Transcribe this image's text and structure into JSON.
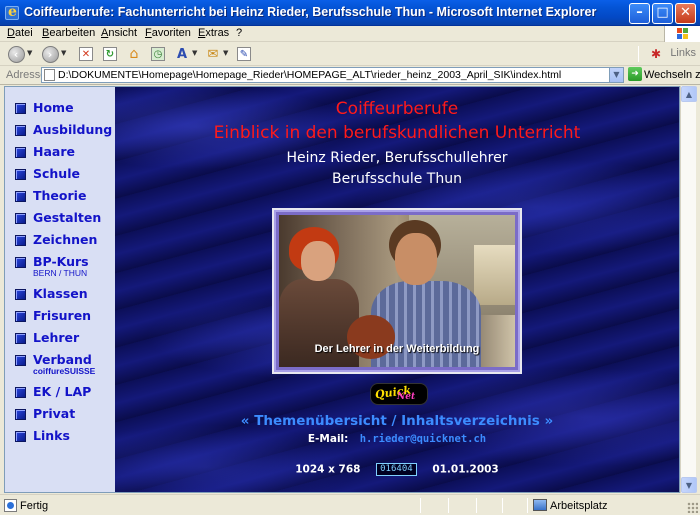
{
  "window": {
    "title": "Coiffeurberufe: Fachunterricht bei Heinz Rieder, Berufsschule Thun - Microsoft Internet Explorer"
  },
  "menu": [
    "Datei",
    "Bearbeiten",
    "Ansicht",
    "Favoriten",
    "Extras",
    "?"
  ],
  "toolbar": {
    "links_label": "Links",
    "icons": [
      "back-icon",
      "forward-icon",
      "stop-icon",
      "refresh-icon",
      "home-icon",
      "history-icon",
      "font-size-icon",
      "mail-icon",
      "edit-icon"
    ]
  },
  "address": {
    "label": "Adresse",
    "url": "D:\\DOKUMENTE\\Homepage\\Homepage_Rieder\\HOMEPAGE_ALT\\rieder_heinz_2003_April_SIK\\index.html",
    "go_label": "Wechseln zu"
  },
  "nav": {
    "items": [
      {
        "label": "Home",
        "sub": ""
      },
      {
        "label": "Ausbildung",
        "sub": ""
      },
      {
        "label": "Haare",
        "sub": ""
      },
      {
        "label": "Schule",
        "sub": ""
      },
      {
        "label": "Theorie",
        "sub": ""
      },
      {
        "label": "Gestalten",
        "sub": ""
      },
      {
        "label": "Zeichnen",
        "sub": ""
      },
      {
        "label": "BP-Kurs",
        "sub": "BERN / THUN"
      },
      {
        "label": "Klassen",
        "sub": ""
      },
      {
        "label": "Frisuren",
        "sub": ""
      },
      {
        "label": "Lehrer",
        "sub": ""
      },
      {
        "label": "Verband",
        "sub": "coiffureSUISSE"
      },
      {
        "label": "EK / LAP",
        "sub": ""
      },
      {
        "label": "Privat",
        "sub": ""
      },
      {
        "label": "Links",
        "sub": ""
      }
    ]
  },
  "main": {
    "heading1": "Coiffeurberufe",
    "heading2": "Einblick in den berufskundlichen Unterricht",
    "author": "Heinz Rieder, Berufsschullehrer",
    "school": "Berufsschule Thun",
    "photo_caption": "Der Lehrer in der Weiterbildung",
    "badge_top": "Quick",
    "badge_bottom": "Net",
    "toc_link": "« Themenübersicht / Inhaltsverzeichnis »",
    "email_label": "E-Mail:",
    "email": "h.rieder@quicknet.ch",
    "resolution": "1024 x 768",
    "counter": "016404",
    "date": "01.01.2003"
  },
  "status": {
    "text": "Fertig",
    "zone": "Arbeitsplatz"
  }
}
